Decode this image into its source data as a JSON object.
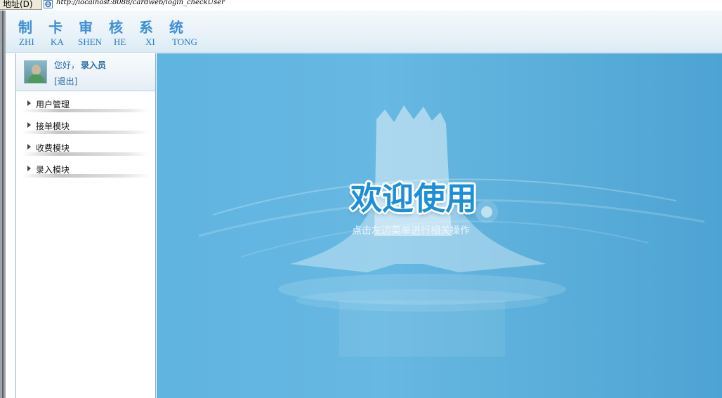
{
  "address_bar": {
    "label": "地址(D)",
    "url": "http://localhost:8088/cardweb/login_checkUser"
  },
  "header": {
    "title_chars": [
      "制",
      "卡",
      "审",
      "核",
      "系",
      "统"
    ],
    "pinyin": [
      "ZHI",
      "KA",
      "SHEN",
      "HE",
      "XI",
      "TONG"
    ]
  },
  "user": {
    "greeting": "您好，",
    "name": "录入员",
    "logout": "[退出]"
  },
  "menu": {
    "items": [
      {
        "label": "用户管理"
      },
      {
        "label": "接单模块"
      },
      {
        "label": "收费模块"
      },
      {
        "label": "录入模块"
      }
    ]
  },
  "main": {
    "welcome": "欢迎使用",
    "hint": "点击左边菜单进行相关操作"
  },
  "colors": {
    "title": "#3d8fd6",
    "link": "#2a6ca6",
    "main_bg": "#5fb4e0",
    "welcome": "#1d8fd8"
  }
}
